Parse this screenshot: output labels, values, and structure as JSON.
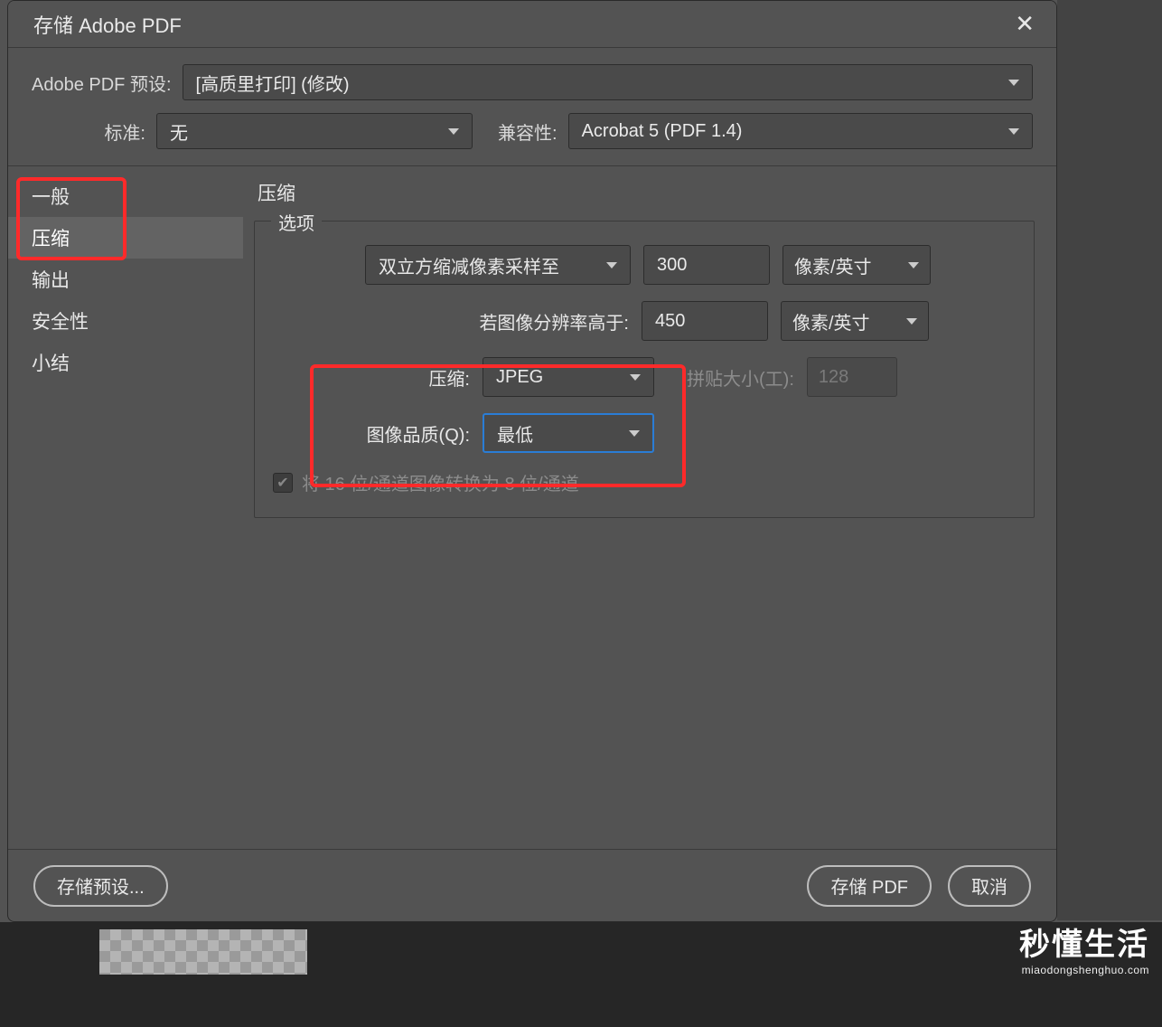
{
  "window": {
    "title": "存储 Adobe PDF"
  },
  "preset": {
    "label": "Adobe PDF 预设:",
    "value": "[高质里打印]  (修改)"
  },
  "standard": {
    "label": "标准:",
    "value": "无"
  },
  "compat": {
    "label": "兼容性:",
    "value": "Acrobat 5 (PDF 1.4)"
  },
  "sidebar": {
    "items": [
      "一般",
      "压缩",
      "输出",
      "安全性",
      "小结"
    ],
    "selected_index": 1
  },
  "section": {
    "title": "压缩",
    "group": "选项"
  },
  "options": {
    "downsample": {
      "method": "双立方缩减像素采样至",
      "value": "300",
      "unit": "像素/英寸"
    },
    "threshold": {
      "label": "若图像分辨率高于:",
      "value": "450",
      "unit": "像素/英寸"
    },
    "compression": {
      "label": "压缩:",
      "value": "JPEG"
    },
    "quality": {
      "label": "图像品质(Q):",
      "value": "最低"
    },
    "tile": {
      "label": "拼贴大小(工):",
      "value": "128"
    },
    "convert16": {
      "label": "将 16 位/通道图像转换为 8 位/通道",
      "checked": true
    }
  },
  "footer": {
    "save_preset": "存储预设...",
    "save_pdf": "存储 PDF",
    "cancel": "取消"
  },
  "watermark": {
    "cn": "秒懂生活",
    "en": "miaodongshenghuo.com"
  }
}
